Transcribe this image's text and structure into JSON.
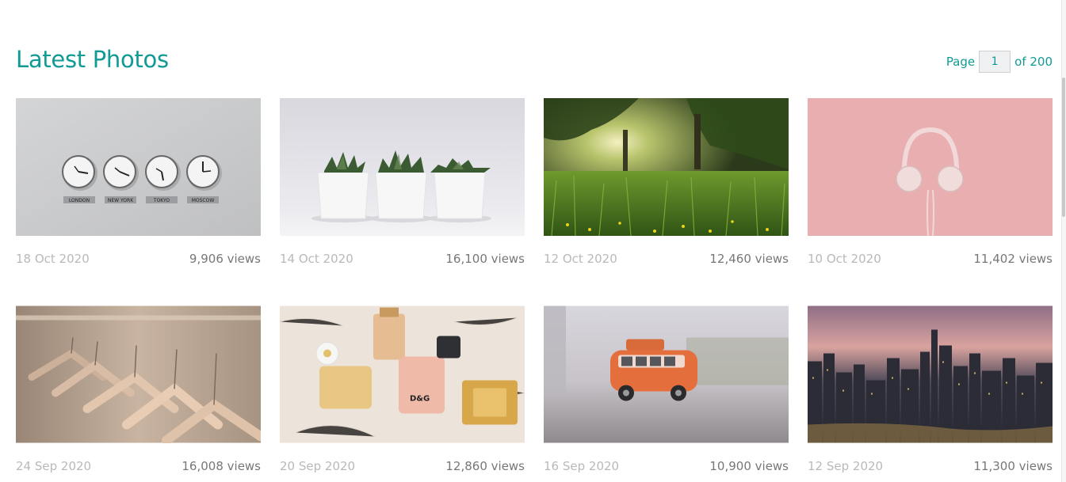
{
  "header": {
    "title": "Latest Photos",
    "pager": {
      "prefix": "Page",
      "current": "1",
      "suffix": "of 200"
    }
  },
  "photos": [
    {
      "date": "18 Oct 2020",
      "views": "9,906 views",
      "subject": "clocks",
      "labels": [
        "LONDON",
        "NEW YORK",
        "TOKYO",
        "MOSCOW"
      ]
    },
    {
      "date": "14 Oct 2020",
      "views": "16,100 views",
      "subject": "succulents"
    },
    {
      "date": "12 Oct 2020",
      "views": "12,460 views",
      "subject": "meadow"
    },
    {
      "date": "10 Oct 2020",
      "views": "11,402 views",
      "subject": "headphones"
    },
    {
      "date": "24 Sep 2020",
      "views": "16,008 views",
      "subject": "hangers"
    },
    {
      "date": "20 Sep 2020",
      "views": "12,860 views",
      "subject": "perfumes",
      "labels": [
        "D&G"
      ]
    },
    {
      "date": "16 Sep 2020",
      "views": "10,900 views",
      "subject": "toy-bus"
    },
    {
      "date": "12 Sep 2020",
      "views": "11,300 views",
      "subject": "city-skyline"
    }
  ],
  "colors": {
    "accent": "#109a96",
    "date_text": "#b9b9b9",
    "views_text": "#777777"
  }
}
